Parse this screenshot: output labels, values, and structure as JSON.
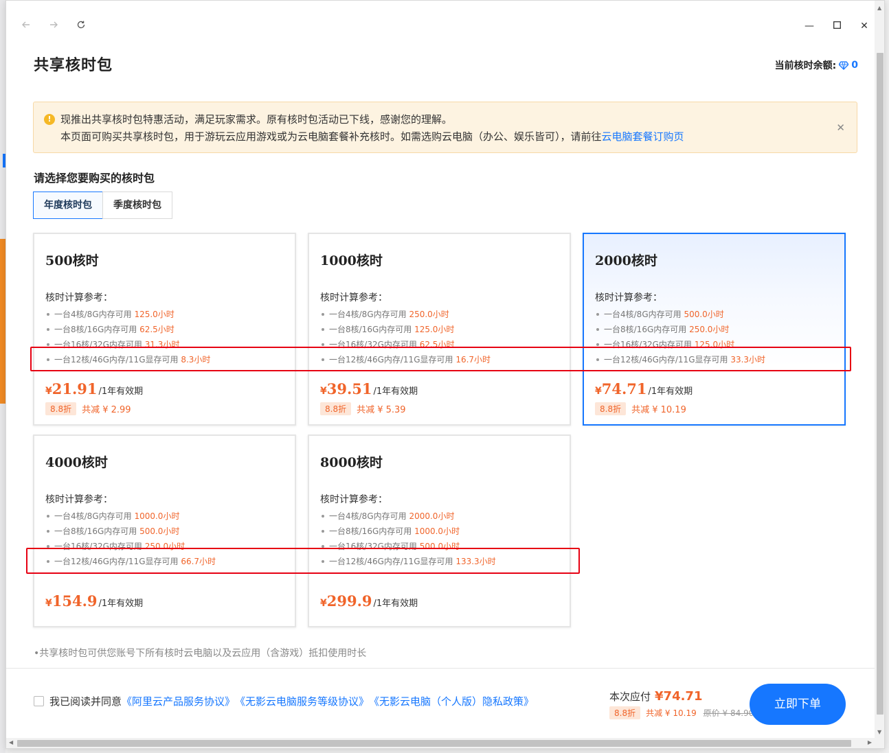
{
  "window": {
    "back_icon": "arrow-left-icon",
    "forward_icon": "arrow-right-icon",
    "refresh_icon": "refresh-icon",
    "minimize_glyph": "—",
    "maximize_glyph": "☐",
    "close_glyph": "✕"
  },
  "header": {
    "title": "共享核时包",
    "balance_label": "当前核时余额:",
    "balance_value": "0"
  },
  "notice": {
    "line1": "现推出共享核时包特惠活动，满足玩家需求。原有核时包活动已下线，感谢您的理解。",
    "line2_prefix": "本页面可购买共享核时包，用于游玩云应用游戏或为云电脑套餐补充核时。如需选购云电脑（办公、娱乐皆可），请前往",
    "line2_link": "云电脑套餐订购页",
    "info_glyph": "!",
    "close_glyph": "✕"
  },
  "section": {
    "label": "请选择您要购买的核时包",
    "tabs": [
      {
        "label": "年度核时包",
        "active": true
      },
      {
        "label": "季度核时包",
        "active": false
      }
    ]
  },
  "packages": [
    {
      "name": "500核时",
      "ref_title": "核时计算参考：",
      "specs": [
        {
          "text": "一台4核/8G内存可用",
          "hours": "125.0小时"
        },
        {
          "text": "一台8核/16G内存可用",
          "hours": "62.5小时"
        },
        {
          "text": "一台16核/32G内存可用",
          "hours": "31.3小时"
        },
        {
          "text": "一台12核/46G内存/11G显存可用",
          "hours": "8.3小时"
        }
      ],
      "currency": "¥",
      "price": "21.91",
      "period": "/1年有效期",
      "discount": "8.8折",
      "saving": "共减 ¥ 2.99",
      "selected": false
    },
    {
      "name": "1000核时",
      "ref_title": "核时计算参考：",
      "specs": [
        {
          "text": "一台4核/8G内存可用",
          "hours": "250.0小时"
        },
        {
          "text": "一台8核/16G内存可用",
          "hours": "125.0小时"
        },
        {
          "text": "一台16核/32G内存可用",
          "hours": "62.5小时"
        },
        {
          "text": "一台12核/46G内存/11G显存可用",
          "hours": "16.7小时"
        }
      ],
      "currency": "¥",
      "price": "39.51",
      "period": "/1年有效期",
      "discount": "8.8折",
      "saving": "共减 ¥ 5.39",
      "selected": false
    },
    {
      "name": "2000核时",
      "ref_title": "核时计算参考：",
      "specs": [
        {
          "text": "一台4核/8G内存可用",
          "hours": "500.0小时"
        },
        {
          "text": "一台8核/16G内存可用",
          "hours": "250.0小时"
        },
        {
          "text": "一台16核/32G内存可用",
          "hours": "125.0小时"
        },
        {
          "text": "一台12核/46G内存/11G显存可用",
          "hours": "33.3小时"
        }
      ],
      "currency": "¥",
      "price": "74.71",
      "period": "/1年有效期",
      "discount": "8.8折",
      "saving": "共减 ¥ 10.19",
      "selected": true
    },
    {
      "name": "4000核时",
      "ref_title": "核时计算参考：",
      "specs": [
        {
          "text": "一台4核/8G内存可用",
          "hours": "1000.0小时"
        },
        {
          "text": "一台8核/16G内存可用",
          "hours": "500.0小时"
        },
        {
          "text": "一台16核/32G内存可用",
          "hours": "250.0小时"
        },
        {
          "text": "一台12核/46G内存/11G显存可用",
          "hours": "66.7小时"
        }
      ],
      "currency": "¥",
      "price": "154.9",
      "period": "/1年有效期",
      "selected": false
    },
    {
      "name": "8000核时",
      "ref_title": "核时计算参考：",
      "specs": [
        {
          "text": "一台4核/8G内存可用",
          "hours": "2000.0小时"
        },
        {
          "text": "一台8核/16G内存可用",
          "hours": "1000.0小时"
        },
        {
          "text": "一台16核/32G内存可用",
          "hours": "500.0小时"
        },
        {
          "text": "一台12核/46G内存/11G显存可用",
          "hours": "133.3小时"
        }
      ],
      "currency": "¥",
      "price": "299.9",
      "period": "/1年有效期",
      "selected": false
    }
  ],
  "foot_note": "•共享核时包可供您账号下所有核时云电脑以及云应用（含游戏）抵扣使用时长",
  "footer": {
    "agree_prefix": "我已阅读并同意",
    "links": [
      "《阿里云产品服务协议》",
      "《无影云电脑服务等级协议》",
      "《无影云电脑（个人版）隐私政策》"
    ],
    "pay_label": "本次应付",
    "pay_amount": "¥74.71",
    "discount": "8.8折",
    "saving": "共减 ¥ 10.19",
    "original": "原价 ¥ 84.90",
    "order_button": "立即下单"
  },
  "colors": {
    "accent": "#1677ff",
    "price": "#f0642a",
    "highlight_box": "#e60012",
    "notice_bg": "#fdf3e1"
  }
}
